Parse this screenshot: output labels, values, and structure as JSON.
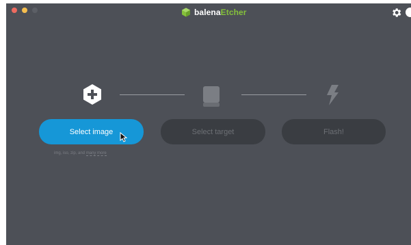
{
  "titlebar": {
    "brand_prefix": "balena",
    "brand_suffix": "Etcher",
    "settings_icon": "gear-icon",
    "help_icon": "help-icon"
  },
  "steps": {
    "image": {
      "icon": "plus-hexagon-icon",
      "button_label": "Select image",
      "hint_prefix": "img, iso, zip, and ",
      "hint_link": "many more"
    },
    "target": {
      "icon": "drive-icon",
      "button_label": "Select target"
    },
    "flash": {
      "icon": "lightning-bolt-icon",
      "button_label": "Flash!"
    }
  },
  "colors": {
    "window_bg": "#4d5057",
    "accent_blue": "#1697d7",
    "brand_green": "#85c13b",
    "disabled_button": "#3a3d42"
  }
}
